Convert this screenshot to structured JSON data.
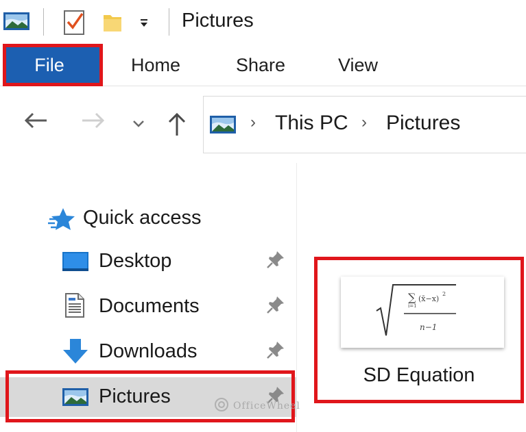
{
  "window": {
    "title": "Pictures"
  },
  "ribbon": {
    "tabs": [
      {
        "label": "File",
        "active": true
      },
      {
        "label": "Home"
      },
      {
        "label": "Share"
      },
      {
        "label": "View"
      }
    ]
  },
  "address": {
    "segments": [
      "This PC",
      "Pictures"
    ]
  },
  "navpane": {
    "quick_access": "Quick access",
    "items": [
      {
        "label": "Desktop",
        "icon": "desktop-icon",
        "pinned": true
      },
      {
        "label": "Documents",
        "icon": "documents-icon",
        "pinned": true
      },
      {
        "label": "Downloads",
        "icon": "downloads-icon",
        "pinned": true
      },
      {
        "label": "Pictures",
        "icon": "pictures-icon",
        "pinned": true,
        "selected": true
      }
    ]
  },
  "content": {
    "files": [
      {
        "name": "SD Equation",
        "type": "image"
      }
    ]
  },
  "watermark": "OfficeWheel",
  "colors": {
    "file_tab": "#1c5fb1",
    "highlight_outline": "#e0161b",
    "selected_row": "#d9d9d9"
  }
}
